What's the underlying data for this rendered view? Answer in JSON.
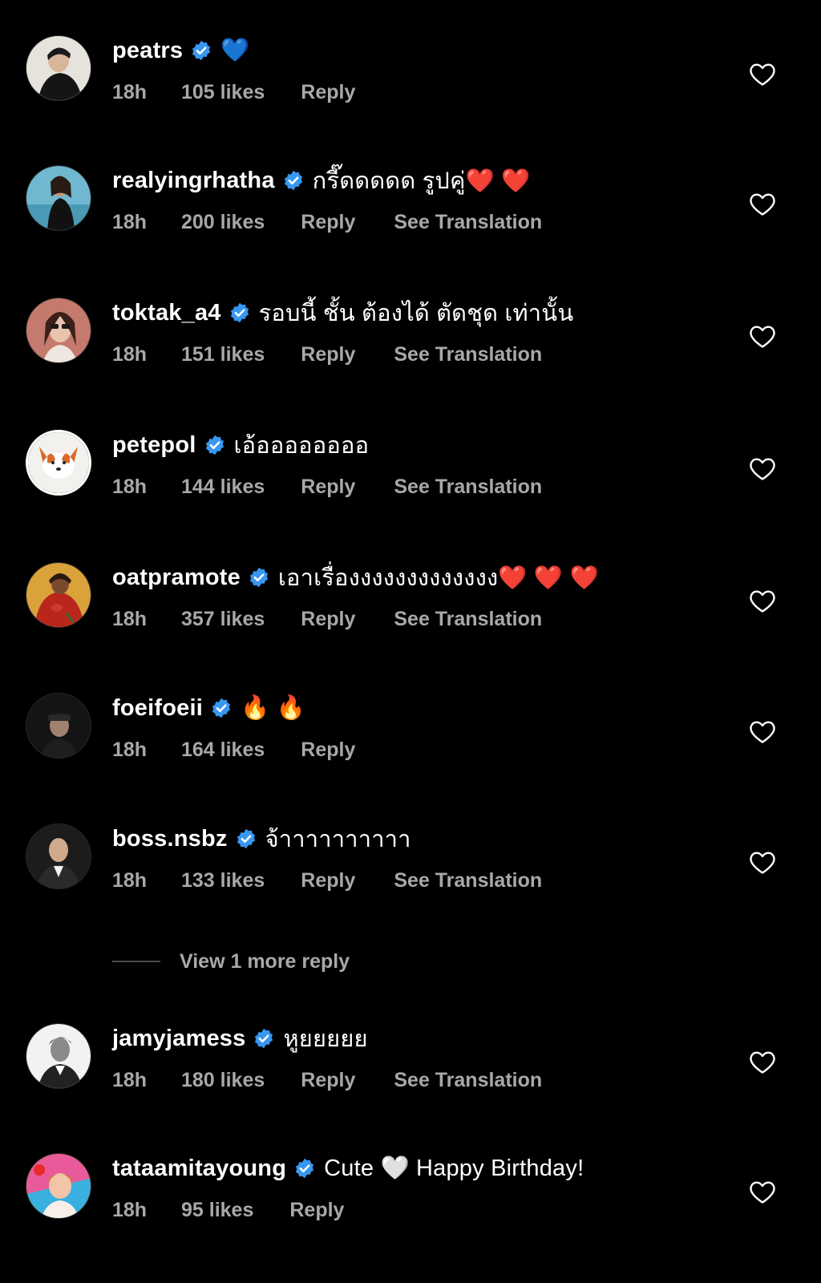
{
  "comments": [
    {
      "username": "peatrs",
      "text": "💙",
      "time": "18h",
      "likes": "105 likes",
      "reply": "Reply",
      "translate": ""
    },
    {
      "username": "realyingrhatha",
      "text": "กรี๊ดดดดด รูปคู่❤️ ❤️",
      "time": "18h",
      "likes": "200 likes",
      "reply": "Reply",
      "translate": "See Translation"
    },
    {
      "username": "toktak_a4",
      "text": "รอบนี้ ชั้น ต้องได้ ตัดชุด เท่านั้น",
      "time": "18h",
      "likes": "151 likes",
      "reply": "Reply",
      "translate": "See Translation"
    },
    {
      "username": "petepol",
      "text": "เอ้ออออออออ",
      "time": "18h",
      "likes": "144 likes",
      "reply": "Reply",
      "translate": "See Translation"
    },
    {
      "username": "oatpramote",
      "text": "เอาเรื่องงงงงงงงงงงงง❤️ ❤️ ❤️",
      "time": "18h",
      "likes": "357 likes",
      "reply": "Reply",
      "translate": "See Translation"
    },
    {
      "username": "foeifoeii",
      "text": "🔥 🔥",
      "time": "18h",
      "likes": "164 likes",
      "reply": "Reply",
      "translate": ""
    },
    {
      "username": "boss.nsbz",
      "text": "จ้าาาาาาาาาา",
      "time": "18h",
      "likes": "133 likes",
      "reply": "Reply",
      "translate": "See Translation"
    },
    {
      "username": "jamyjamess",
      "text": "หูยยยยย",
      "time": "18h",
      "likes": "180 likes",
      "reply": "Reply",
      "translate": "See Translation"
    },
    {
      "username": "tataamitayoung",
      "text": "Cute 🤍 Happy Birthday!",
      "time": "18h",
      "likes": "95 likes",
      "reply": "Reply",
      "translate": ""
    }
  ],
  "view_more_replies": "View 1 more reply",
  "colors": {
    "background": "#000000",
    "primary_text": "#ffffff",
    "secondary_text": "#a8a8a8",
    "verified_badge": "#3897f0"
  },
  "icons": {
    "verified": "verified-badge-icon",
    "like": "heart-outline-icon"
  }
}
